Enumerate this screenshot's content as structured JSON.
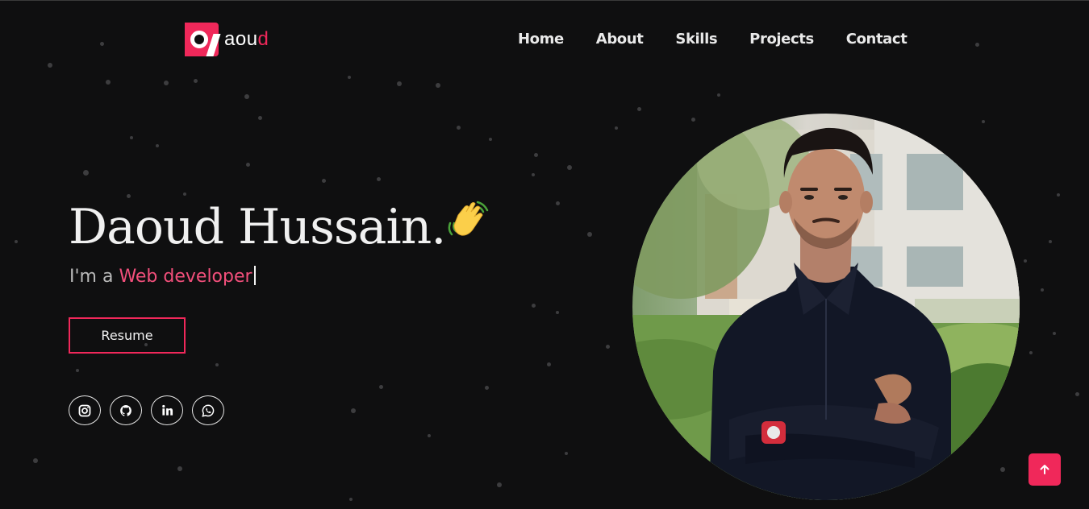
{
  "logo": {
    "mark_letter": "D",
    "text_main": "aou",
    "text_accent": "d"
  },
  "nav": {
    "items": [
      "Home",
      "About",
      "Skills",
      "Projects",
      "Contact"
    ]
  },
  "hero": {
    "name": "Daoud Hussain.",
    "subtitle_prefix": "I'm a ",
    "subtitle_role": "Web developer",
    "resume_label": "Resume"
  },
  "socials": [
    "instagram-icon",
    "github-icon",
    "linkedin-icon",
    "whatsapp-icon"
  ],
  "colors": {
    "accent": "#f0285a",
    "background": "#0f0f10",
    "role_text": "#f24f7b"
  },
  "icons": {
    "wave": "waving-hand-icon",
    "back_to_top": "arrow-up-icon"
  }
}
